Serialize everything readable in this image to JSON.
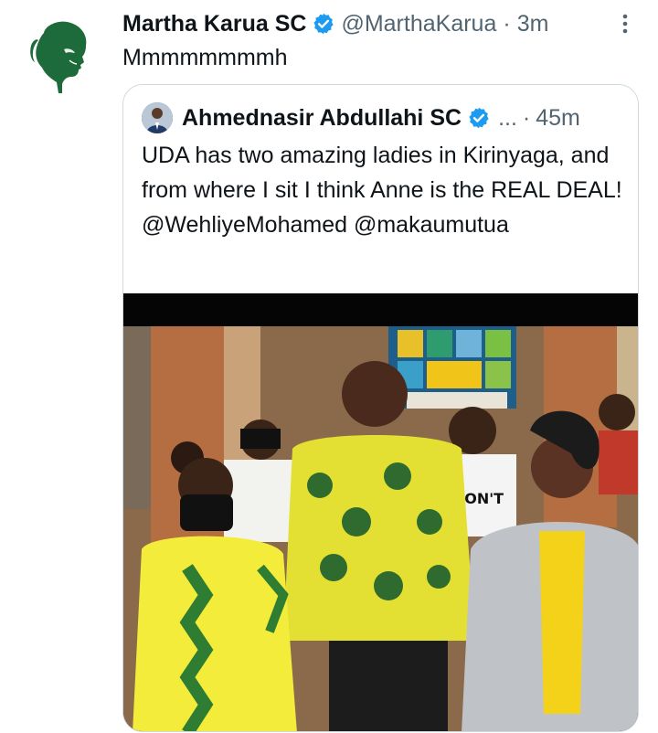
{
  "tweet": {
    "author_name": "Martha Karua SC",
    "handle": "@MarthaKarua",
    "separator": "·",
    "time": "3m",
    "text": "Mmmmmmmmh",
    "more_icon": "more-vert-icon",
    "verified_icon": "verified-badge-icon"
  },
  "quote": {
    "author_name": "Ahmednasir Abdullahi SC",
    "ellipsis": "...",
    "separator": "·",
    "time": "45m",
    "text": "UDA has two amazing ladies in Kirinyaga, and from where I sit I think Anne is the REAL DEAL! @WehliyeMohamed @makaumutua",
    "media": {
      "description_icon": "photo",
      "shirt_text": "DON'T"
    }
  },
  "colors": {
    "brand_green": "#1d6b3a",
    "verified_blue": "#1d9bf0",
    "muted_text": "#536471",
    "border": "#cfd9de"
  }
}
